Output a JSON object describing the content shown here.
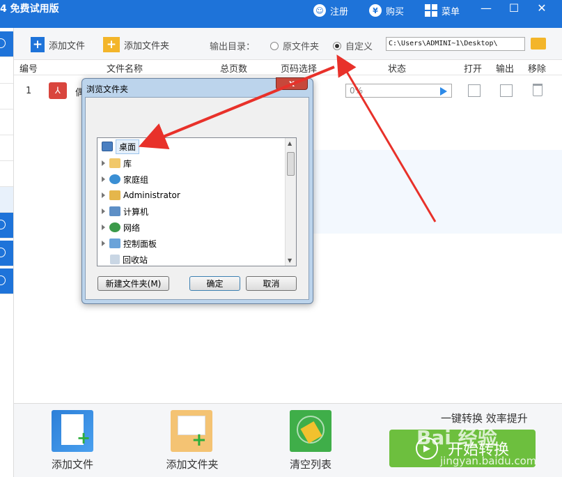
{
  "window": {
    "title": "4 免费试用版",
    "register_label": "注册",
    "buy_label": "购买",
    "menu_label": "菜单",
    "minimize": "—",
    "maximize": "☐",
    "close": "✕"
  },
  "toolbar": {
    "add_file_label": "添加文件",
    "add_folder_label": "添加文件夹",
    "output_dir_label": "输出目录：",
    "option_original": "原文件夹",
    "option_custom": "自定义",
    "selected_option": "自定义",
    "output_path": "C:\\Users\\ADMINI~1\\Desktop\\"
  },
  "table": {
    "headers": [
      "编号",
      "文件名称",
      "总页数",
      "页码选择",
      "状态",
      "打开",
      "输出",
      "移除"
    ],
    "rows": [
      {
        "index": "1",
        "file_prefix": "偶",
        "status": "0%"
      }
    ]
  },
  "dialog": {
    "title": "浏览文件夹",
    "close": "x",
    "tree": [
      {
        "label": "桌面",
        "selected": true,
        "icon": "desktop-icon"
      },
      {
        "label": "库",
        "icon": "library-icon"
      },
      {
        "label": "家庭组",
        "icon": "homegroup-icon"
      },
      {
        "label": "Administrator",
        "icon": "user-folder-icon"
      },
      {
        "label": "计算机",
        "icon": "computer-icon"
      },
      {
        "label": "网络",
        "icon": "network-icon"
      },
      {
        "label": "控制面板",
        "icon": "control-panel-icon"
      },
      {
        "label": "回收站",
        "icon": "recycle-bin-icon"
      }
    ],
    "new_folder_label": "新建文件夹(M)",
    "ok_label": "确定",
    "cancel_label": "取消"
  },
  "bottom": {
    "add_file_label": "添加文件",
    "add_folder_label": "添加文件夹",
    "clear_list_label": "清空列表",
    "slogan": "一键转换  效率提升",
    "start_label": "开始转换"
  },
  "watermark": {
    "brand": "Bai 经验",
    "url": "jingyan.baidu.com"
  },
  "colors": {
    "accent": "#1e73d9",
    "start_button": "#6dbf3e",
    "annotation_arrow": "#e8312a"
  }
}
